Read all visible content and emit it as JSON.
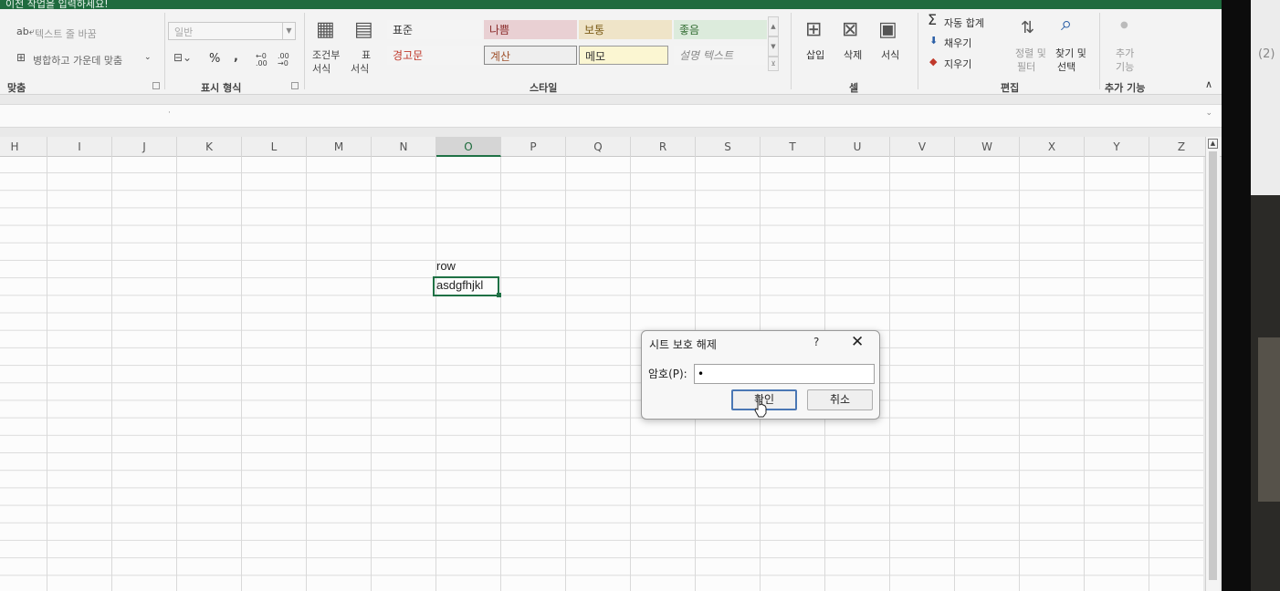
{
  "window": {
    "title_partial": "이전 작업을 입력하세요!"
  },
  "ribbon": {
    "alignment": {
      "wrap_text": "텍스트 줄 바꿈",
      "merge_center": "병합하고 가운데 맞춤",
      "group_label": "맞춤"
    },
    "number": {
      "format_value": "일반",
      "percent": "%",
      "comma": ",",
      "inc_decimal": "←0 .00",
      "dec_decimal": ".00 →0",
      "group_label": "표시 형식"
    },
    "styles": {
      "conditional": [
        "조건부",
        "서식"
      ],
      "format_table": [
        "표",
        "서식"
      ],
      "cells": [
        [
          "표준",
          "나쁨",
          "보통",
          "좋음"
        ],
        [
          "경고문",
          "계산",
          "메모",
          "설명 텍스트"
        ]
      ],
      "group_label": "스타일"
    },
    "cells": {
      "insert": "삽입",
      "delete": "삭제",
      "format": "서식",
      "group_label": "셀"
    },
    "editing": {
      "autosum": "자동 합계",
      "fill": "채우기",
      "clear": "지우기",
      "sort_filter": [
        "정렬 및",
        "필터"
      ],
      "find_select": [
        "찾기 및",
        "선택"
      ],
      "group_label": "편집"
    },
    "addins": {
      "label": [
        "추가",
        "기능"
      ],
      "group_label": "추가 기능"
    }
  },
  "columns": [
    "H",
    "I",
    "J",
    "K",
    "L",
    "M",
    "N",
    "O",
    "P",
    "Q",
    "R",
    "S",
    "T",
    "U",
    "V",
    "W",
    "X",
    "Y",
    "Z"
  ],
  "selected_column": "O",
  "cells": {
    "o_header": "row",
    "o_value": "asdgfhjkl"
  },
  "dialog": {
    "title": "시트 보호 해제",
    "help": "?",
    "close": "✕",
    "password_label": "암호(P):",
    "password_value": "•",
    "ok": "확인",
    "cancel": "취소"
  },
  "side_window": {
    "text": "(2)"
  },
  "colors": {
    "excel_green": "#1f7145",
    "dialog_focus": "#4a77b4"
  }
}
